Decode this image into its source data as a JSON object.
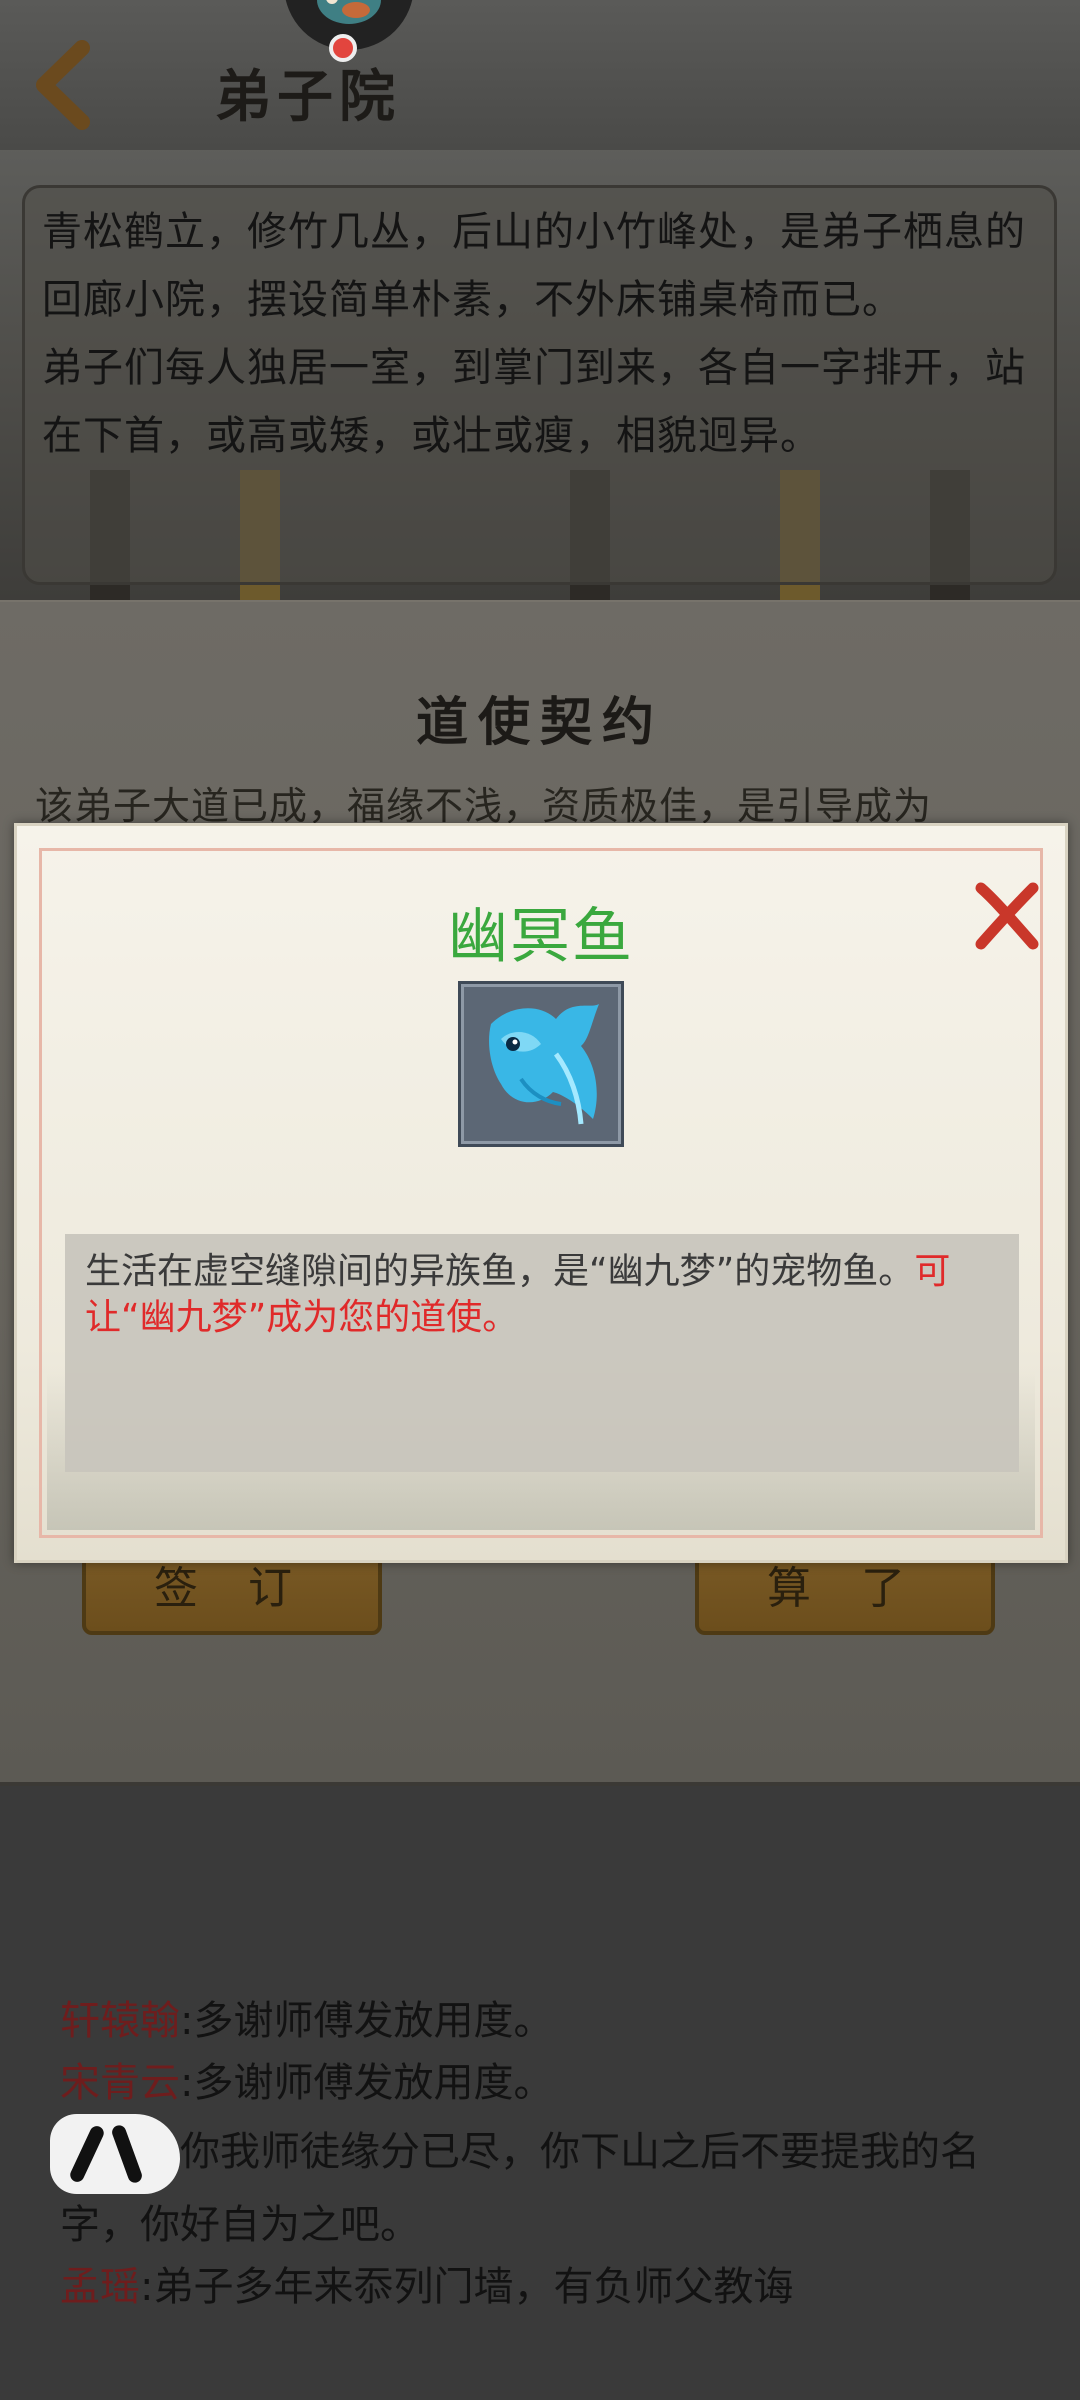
{
  "header": {
    "title": "弟子院"
  },
  "description": {
    "paragraphs": [
      "青松鹤立，修竹几丛，后山的小竹峰处，是弟子栖息的回廊小院，摆设简单朴素，不外床铺桌椅而已。",
      "弟子们每人独居一室，到掌门到来，各自一字排开，站在下首，或高或矮，或壮或瘦，相貌迥异。"
    ]
  },
  "contract": {
    "title": "道使契约",
    "text": "该弟子大道已成，福缘不浅，资质极佳，是引导成为",
    "sign_label": "签 订",
    "cancel_label": "算 了"
  },
  "chat": {
    "lines": [
      {
        "name": "轩辕翰",
        "text": ":多谢师傅发放用度。"
      },
      {
        "name": "宋青云",
        "text": ":多谢师傅发放用度。"
      },
      {
        "name": "",
        "text": "你我师徒缘分已尽，你下山之后不要提我的名字，你好自为之吧。"
      },
      {
        "name": "孟瑶",
        "text": ":弟子多年来忝列门墙，有负师父教诲"
      }
    ]
  },
  "modal": {
    "title": "幽冥鱼",
    "item_icon": "blue-fish-icon",
    "description_normal": "生活在虚空缝隙间的异族鱼，是“幽九梦”的宠物鱼。",
    "description_highlight": "可让“幽九梦”成为您的道使。",
    "title_color": "#3aa83e",
    "highlight_color": "#e02a2a",
    "close_icon": "close-x-icon"
  }
}
